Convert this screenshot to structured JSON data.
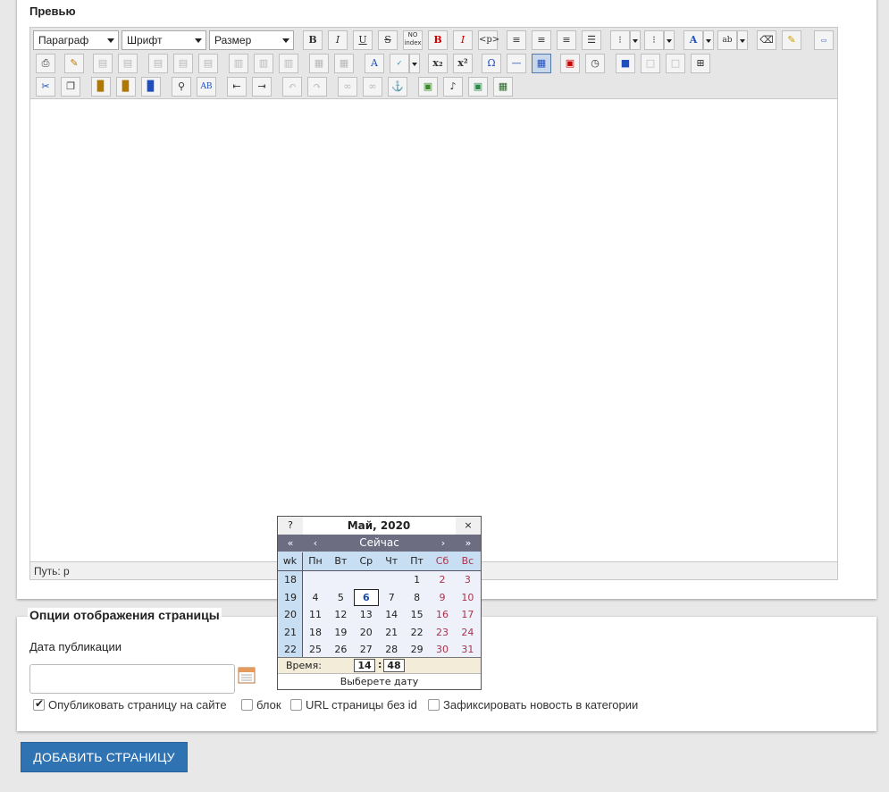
{
  "preview": {
    "title": "Превью"
  },
  "toolbar": {
    "format_select": "Параграф",
    "font_select": "Шрифт",
    "size_select": "Размер",
    "bold_label": "B",
    "italic_label": "I",
    "underline_label": "U",
    "strike_label": "S",
    "noindex_label": "NO index",
    "subscript_label": "x₂",
    "superscript_label": "x²",
    "omega_label": "Ω"
  },
  "statusbar": {
    "path": "Путь: p"
  },
  "calendar": {
    "help": "?",
    "title": "Май, 2020",
    "close": "×",
    "nav_prev_year": "«",
    "nav_prev_month": "‹",
    "nav_today": "Сейчас",
    "nav_next_month": "›",
    "nav_next_year": "»",
    "wk_header": "wk",
    "days_of_week": [
      "Пн",
      "Вт",
      "Ср",
      "Чт",
      "Пт",
      "Сб",
      "Вс"
    ],
    "weeks": [
      {
        "wk": "18",
        "days": [
          "",
          "",
          "",
          "",
          "1",
          "2",
          "3"
        ]
      },
      {
        "wk": "19",
        "days": [
          "4",
          "5",
          "6",
          "7",
          "8",
          "9",
          "10"
        ]
      },
      {
        "wk": "20",
        "days": [
          "11",
          "12",
          "13",
          "14",
          "15",
          "16",
          "17"
        ]
      },
      {
        "wk": "21",
        "days": [
          "18",
          "19",
          "20",
          "21",
          "22",
          "23",
          "24"
        ]
      },
      {
        "wk": "22",
        "days": [
          "25",
          "26",
          "27",
          "28",
          "29",
          "30",
          "31"
        ]
      }
    ],
    "selected_day": "6",
    "time_label": "Время:",
    "hours": "14",
    "time_sep": ":",
    "minutes": "48",
    "footer": "Выберете дату"
  },
  "options": {
    "title": "Опции отображения страницы",
    "date_label": "Дата публикации",
    "date_value": "",
    "checkboxes": [
      {
        "label": "Опубликовать страницу на сайте",
        "checked": true
      },
      {
        "label": "блок",
        "checked": false
      },
      {
        "label": "URL страницы без id",
        "checked": false
      },
      {
        "label": "Зафиксировать новость в категории",
        "checked": false
      }
    ]
  },
  "actions": {
    "add_page": "ДОБАВИТЬ СТРАНИЦУ"
  },
  "colors": {
    "accent": "#2f73b3",
    "calendar_nav": "#6d6d82",
    "weekend": "#a8344c",
    "selected_day": "#1a4aa8"
  }
}
